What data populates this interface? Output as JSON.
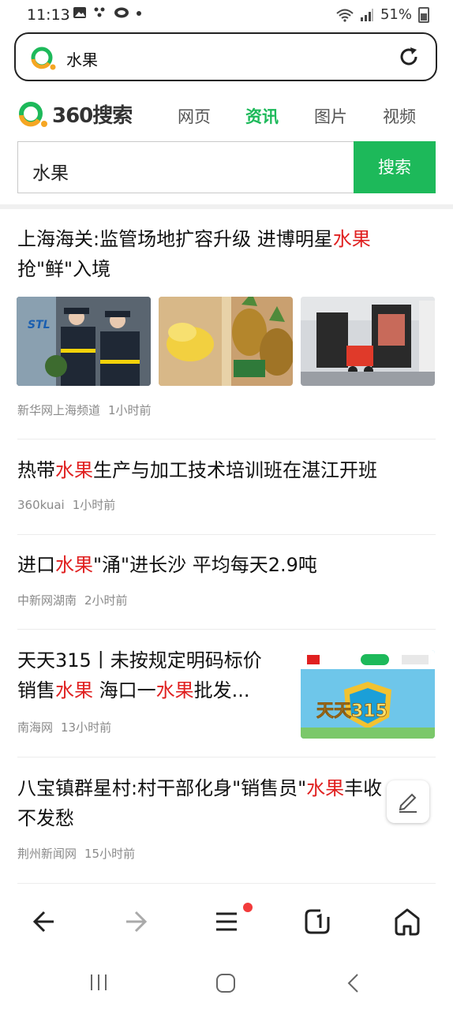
{
  "status_bar": {
    "time": "11:13",
    "battery": "51%"
  },
  "url_bar": {
    "query": "水果"
  },
  "brand": {
    "name": "360搜索"
  },
  "nav": {
    "tabs": [
      {
        "label": "网页"
      },
      {
        "label": "资讯"
      },
      {
        "label": "图片"
      },
      {
        "label": "视频"
      }
    ]
  },
  "search": {
    "value": "水果",
    "button_label": "搜索"
  },
  "news": [
    {
      "title_parts": [
        "上海海关:监管场地扩容升级 进博明星",
        "水果",
        "抢\"鲜\"入境"
      ],
      "source": "新华网上海频道",
      "time": "1小时前"
    },
    {
      "title_parts": [
        "热带",
        "水果",
        "生产与加工技术培训班在湛江开班"
      ],
      "source": "360kuai",
      "time": "1小时前"
    },
    {
      "title_parts": [
        "进口",
        "水果",
        "\"涌\"进长沙 平均每天2.9吨"
      ],
      "source": "中新网湖南",
      "time": "2小时前"
    },
    {
      "title_parts": [
        "天天315丨未按规定明码标价",
        "销售",
        "水果",
        " 海口一",
        "水果",
        "批发..."
      ],
      "source": "南海网",
      "time": "13小时前",
      "thumb_text": "天天315"
    },
    {
      "title_parts": [
        "八宝镇群星村:村干部化身\"销售员\"",
        "水果",
        "丰收",
        "不发愁"
      ],
      "source": "荆州新闻网",
      "time": "15小时前"
    }
  ],
  "colors": {
    "accent": "#1db95a",
    "highlight": "#e02020"
  }
}
